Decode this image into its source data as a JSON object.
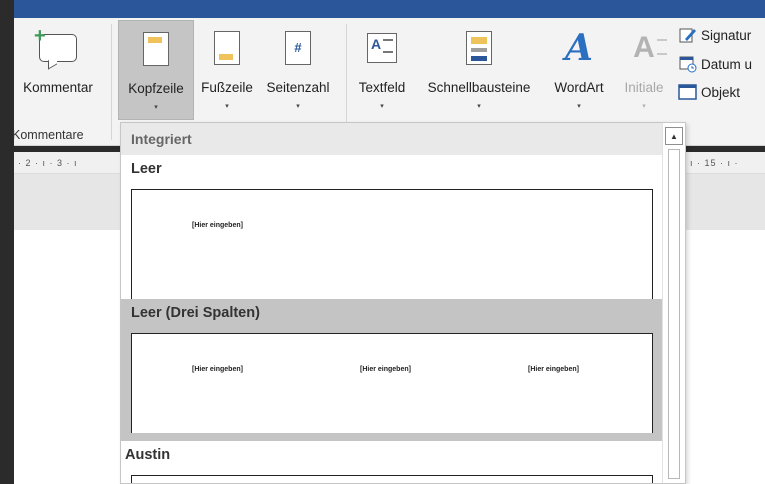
{
  "ribbon": {
    "buttons": {
      "kommentar": "Kommentar",
      "kopfzeile": "Kopfzeile",
      "fusszeile": "Fußzeile",
      "seitenzahl": "Seitenzahl",
      "textfeld": "Textfeld",
      "schnellbausteine": "Schnellbausteine",
      "wordart": "WordArt",
      "initiale": "Initiale",
      "seitenzahl_glyph": "#",
      "wordart_glyph": "A",
      "initiale_glyph": "A",
      "textfeld_glyph": "A"
    },
    "groups": {
      "kommentare": "Kommentare"
    },
    "small": {
      "signatur": "Signatur",
      "datum": "Datum u",
      "objekt": "Objekt"
    },
    "caret": "▾"
  },
  "ruler": {
    "left_marks": "· 2 · ı · 3 · ı",
    "right_marks": "ı · 15 · ı ·"
  },
  "dropdown": {
    "header": "Integriert",
    "scroll_up": "▲",
    "items": [
      {
        "label": "Leer",
        "placeholders": [
          "[Hier eingeben]"
        ]
      },
      {
        "label": "Leer (Drei Spalten)",
        "placeholders": [
          "[Hier eingeben]",
          "[Hier eingeben]",
          "[Hier eingeben]"
        ]
      },
      {
        "label": "Austin",
        "placeholders": []
      }
    ]
  },
  "colors": {
    "accent": "#2b579a",
    "selected_item": "#c4c4c4",
    "header_band": "#f0c25c"
  }
}
